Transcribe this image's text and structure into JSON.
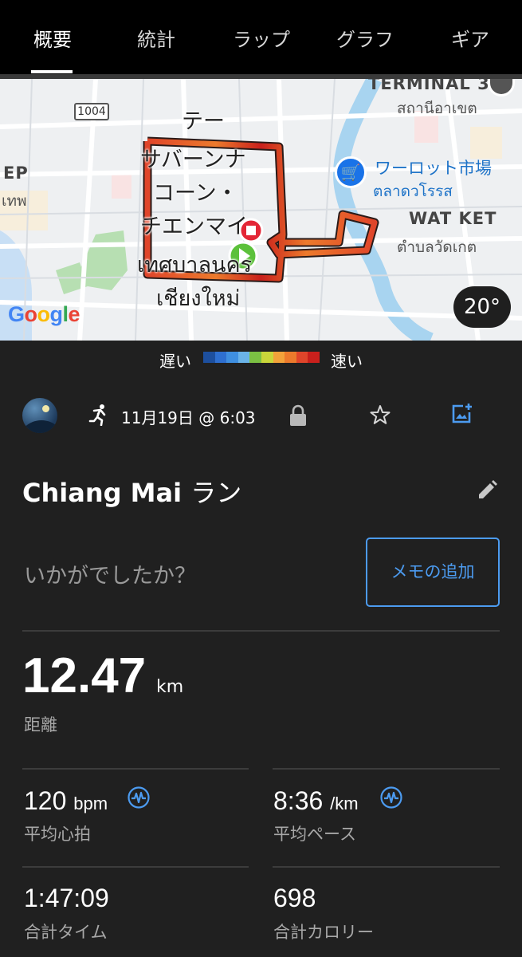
{
  "tabs": [
    {
      "label": "概要",
      "active": true
    },
    {
      "label": "統計",
      "active": false
    },
    {
      "label": "ラップ",
      "active": false
    },
    {
      "label": "グラフ",
      "active": false
    },
    {
      "label": "ギア",
      "active": false
    }
  ],
  "map": {
    "road_number": "1004",
    "labels": {
      "terminal": "TERMINAL 3",
      "terminal_thai": "สถานีอาเขต",
      "market": "ワーロット市場",
      "market_thai": "ตลาดวโรรส",
      "watket": "WAT KET",
      "watket_thai": "ตำบลวัดเกต",
      "city_line1": "テー",
      "city_line2": "サバーンナ",
      "city_line3": "コーン・",
      "city_line4": "チエンマイ",
      "city_thai1": "เทศบาลนคร",
      "city_thai2": "เชียงใหม่",
      "ep": "EP",
      "thep": "เทพ"
    },
    "google": "Google",
    "temperature": "20°"
  },
  "legend": {
    "slow": "遅い",
    "fast": "速い",
    "colors": [
      "#1d4f9e",
      "#2e6fd0",
      "#3f8fe0",
      "#6ab3e8",
      "#7bc043",
      "#c9d63a",
      "#f2a23a",
      "#ec7a2c",
      "#e0452a",
      "#c9201c"
    ]
  },
  "activity": {
    "icon": "running-icon",
    "date": "11月19日 @ 6:03",
    "title_name": "Chiang Mai",
    "title_type": "ラン",
    "feeling_prompt": "いかがでしたか？",
    "memo_button": "メモの追加"
  },
  "stats": {
    "distance": {
      "value": "12.47",
      "unit": "km",
      "label": "距離"
    },
    "avg_hr": {
      "value": "120",
      "unit": "bpm",
      "label": "平均心拍"
    },
    "avg_pace": {
      "value": "8:36",
      "unit": "/km",
      "label": "平均ペース"
    },
    "total_time": {
      "value": "1:47:09",
      "label": "合計タイム"
    },
    "calories": {
      "value": "698",
      "label": "合計カロリー"
    }
  },
  "colors": {
    "accent": "#4c9bf0",
    "background": "#202020",
    "tabbar": "#000000"
  }
}
